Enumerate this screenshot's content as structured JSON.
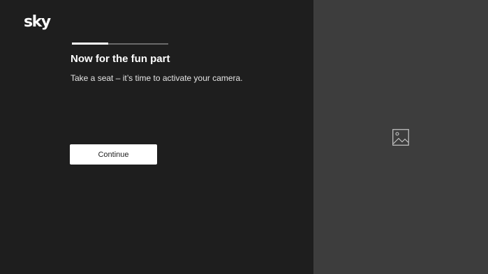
{
  "brand": {
    "logo_text": "sky"
  },
  "progress": {
    "value": 0.38
  },
  "main": {
    "title": "Now for the fun part",
    "subtitle": "Take a seat – it’s time to activate your camera.",
    "continue_label": "Continue"
  },
  "image_panel": {
    "icon": "image-icon"
  },
  "colors": {
    "background": "#1e1e1e",
    "panel": "#3d3d3d",
    "accent": "#ffffff"
  }
}
